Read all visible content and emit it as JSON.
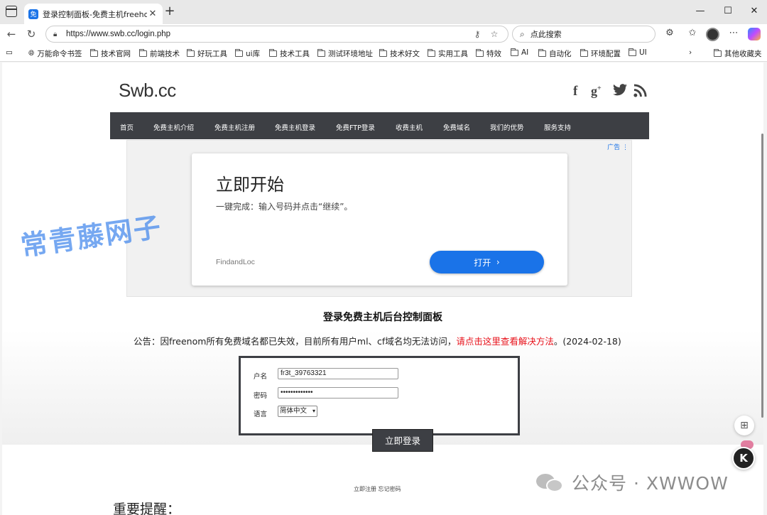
{
  "browser": {
    "tab_title": "登录控制面板-免费主机freehost.c",
    "tab_favicon": "免",
    "url": "https://www.swb.cc/login.php",
    "search_placeholder": "点此搜索"
  },
  "bookmarks": [
    "万能命令书签",
    "技术官网",
    "前端技术",
    "好玩工具",
    "ui库",
    "技术工具",
    "测试环境地址",
    "技术好文",
    "实用工具",
    "特效",
    "AI",
    "自动化",
    "环境配置",
    "UI",
    "其他收藏夹"
  ],
  "site": {
    "logo": "Swb.cc",
    "social": [
      "f",
      "g+",
      "t",
      "rss"
    ],
    "nav": [
      "首页",
      "免费主机介绍",
      "免费主机注册",
      "免费主机登录",
      "免费FTP登录",
      "收费主机",
      "免费域名",
      "我们的优势",
      "服务支持"
    ]
  },
  "ad": {
    "tag": "广告",
    "title": "立即开始",
    "subtitle": "一键完成：输入号码并点击“继续”。",
    "brand": "FindandLoc",
    "button": "打开"
  },
  "watermark": "常青藤网子",
  "login": {
    "title": "登录免费主机后台控制面板",
    "notice_prefix": "公告：因freenom所有免费域名都已失效，目前所有用户ml、cf域名均无法访问，",
    "notice_link": "请点击这里查看解决方法",
    "notice_suffix": "。(2024-02-18)",
    "username_label": "户名",
    "username_value": "fr3t_39763321",
    "password_label": "密码",
    "password_value": "•••••••••••••",
    "language_label": "语言",
    "language_value": "简体中文",
    "submit": "立即登录",
    "register_link": "立即注册",
    "forgot_link": "忘记密码"
  },
  "reminder": "重要提醒：",
  "wechat_credit": "公众号 · XWWOW"
}
